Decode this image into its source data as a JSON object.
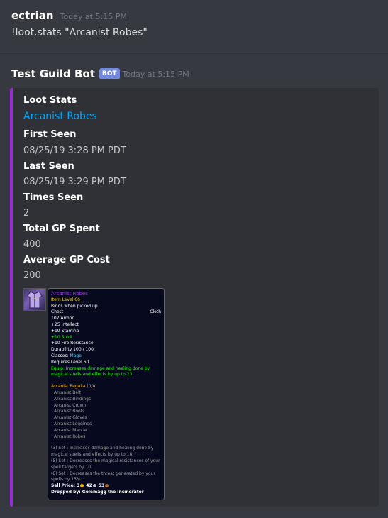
{
  "message1": {
    "author": "ectrian",
    "timestamp": "Today at 5:15 PM",
    "content": "!loot.stats \"Arcanist Robes\""
  },
  "message2": {
    "author": "Test Guild Bot",
    "badge": "BOT",
    "timestamp": "Today at 5:15 PM"
  },
  "embed": {
    "accent_color": "#9b27df",
    "title": "Loot Stats",
    "link": "Arcanist Robes",
    "fields": [
      {
        "name": "First Seen",
        "value": "08/25/19 3:28 PM PDT"
      },
      {
        "name": "Last Seen",
        "value": "08/25/19 3:29 PM PDT"
      },
      {
        "name": "Times Seen",
        "value": "2"
      },
      {
        "name": "Total GP Spent",
        "value": "400"
      },
      {
        "name": "Average GP Cost",
        "value": "200"
      }
    ]
  },
  "tooltip": {
    "icon": "robe-icon",
    "name": "Arcanist Robes",
    "item_level": "Item Level 66",
    "binds": "Binds when picked up",
    "slot": "Chest",
    "type": "Cloth",
    "armor": "102 Armor",
    "intellect": "+25 Intellect",
    "stamina": "+19 Stamina",
    "spirit": "+10 Spirit",
    "fire_res": "+10 Fire Resistance",
    "durability": "Durability 100 / 100",
    "classes_label": "Classes:",
    "classes_value": "Mage",
    "requires": "Requires Level 60",
    "equip": "Equip: Increases damage and healing done by magical spells and effects by up to 23.",
    "set_name": "Arcanist Regalia (0/8)",
    "set_items": [
      "Arcanist Belt",
      "Arcanist Bindings",
      "Arcanist Crown",
      "Arcanist Boots",
      "Arcanist Gloves",
      "Arcanist Leggings",
      "Arcanist Mantle",
      "Arcanist Robes"
    ],
    "set_bonuses": [
      "(3) Set : Increases damage and healing done by magical spells and effects by up to 18.",
      "(5) Set : Decreases the magical resistances of your spell targets by 10.",
      "(8) Set : Decreases the threat generated by your spells by 15%."
    ],
    "sell_label": "Sell Price:",
    "sell_gold": "3",
    "sell_silver": "42",
    "sell_copper": "53",
    "dropped_by": "Dropped by: Golemagg the Incinerator"
  }
}
